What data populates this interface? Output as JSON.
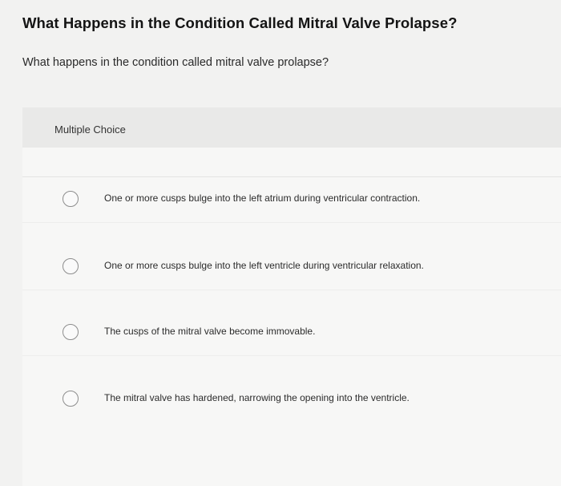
{
  "title": "What Happens in the Condition Called Mitral Valve Prolapse?",
  "question": "What happens in the condition called mitral valve prolapse?",
  "question_type": "Multiple Choice",
  "options": [
    {
      "label": "One or more cusps bulge into the left atrium during ventricular contraction.",
      "selected": false
    },
    {
      "label": "One or more cusps bulge into the left ventricle during ventricular relaxation.",
      "selected": false
    },
    {
      "label": "The cusps of the mitral valve become immovable.",
      "selected": false
    },
    {
      "label": "The mitral valve has hardened, narrowing the opening into the ventricle.",
      "selected": false
    }
  ]
}
